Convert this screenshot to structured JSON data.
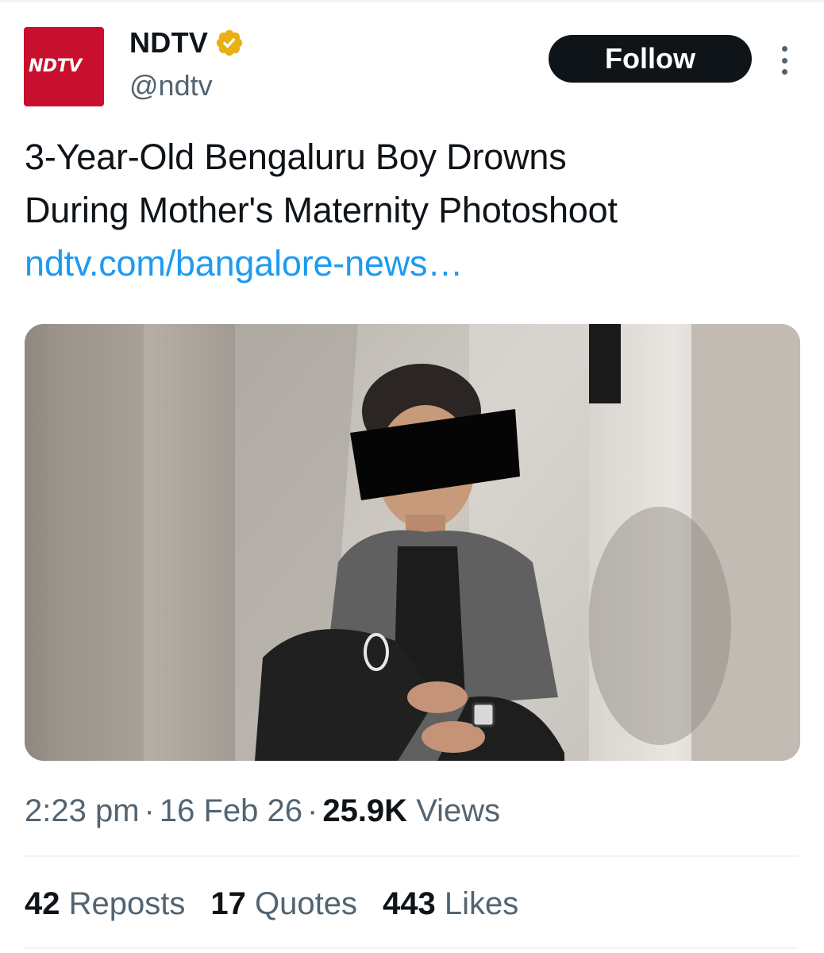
{
  "author": {
    "display_name": "NDTV",
    "handle": "@ndtv",
    "avatar_text": "NDTV",
    "verified": true,
    "verified_color": "#e8b014"
  },
  "actions": {
    "follow_label": "Follow",
    "more_icon": "more-vertical-icon"
  },
  "tweet": {
    "line1": "3-Year-Old Bengaluru Boy Drowns",
    "line2": "During Mother's Maternity Photoshoot",
    "link": "ndtv.com/bangalore-news…",
    "link_color": "#1d9bf0"
  },
  "media": {
    "description_icon": "photo-image"
  },
  "meta": {
    "time": "2:23 pm",
    "separator": "·",
    "date": "16 Feb 26",
    "views_count": "25.9K",
    "views_label": "Views"
  },
  "stats": [
    {
      "count": "42",
      "label": "Reposts"
    },
    {
      "count": "17",
      "label": "Quotes"
    },
    {
      "count": "443",
      "label": "Likes"
    }
  ],
  "colors": {
    "text_primary": "#0f1419",
    "text_secondary": "#536471",
    "avatar_bg": "#c8102e",
    "button_bg": "#0f1419"
  }
}
